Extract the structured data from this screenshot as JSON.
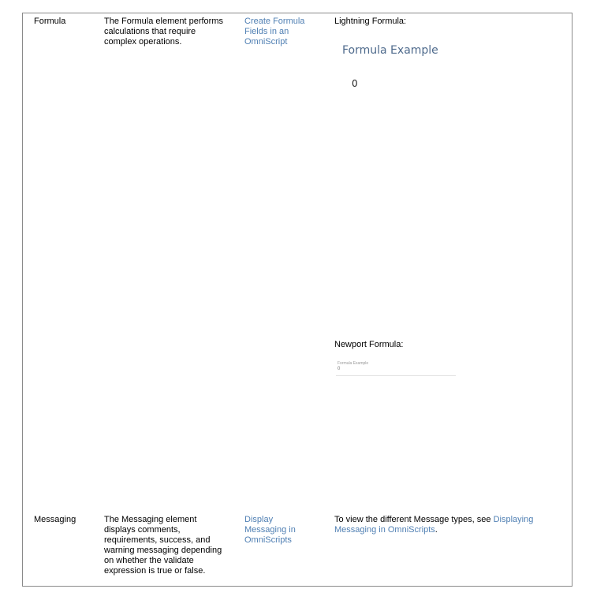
{
  "rows": [
    {
      "element": "Formula",
      "description": "The Formula element performs calculations that require complex operations.",
      "link": "Create Formula Fields in an OmniScript",
      "lightning_label": "Lightning Formula:",
      "lightning_example_title": "Formula Example",
      "lightning_example_value": "0",
      "newport_label": "Newport Formula:",
      "newport_example_title": "Formula Example",
      "newport_example_value": "0"
    },
    {
      "element": "Messaging",
      "description": "The Messaging element displays comments, requirements, success, and warning messaging depending on whether the validate expression is true or false.",
      "link": "Display Messaging in OmniScripts",
      "example_text": "To view the different Message types, see",
      "example_link": "Displaying Messaging in OmniScripts",
      "example_end": "."
    }
  ]
}
